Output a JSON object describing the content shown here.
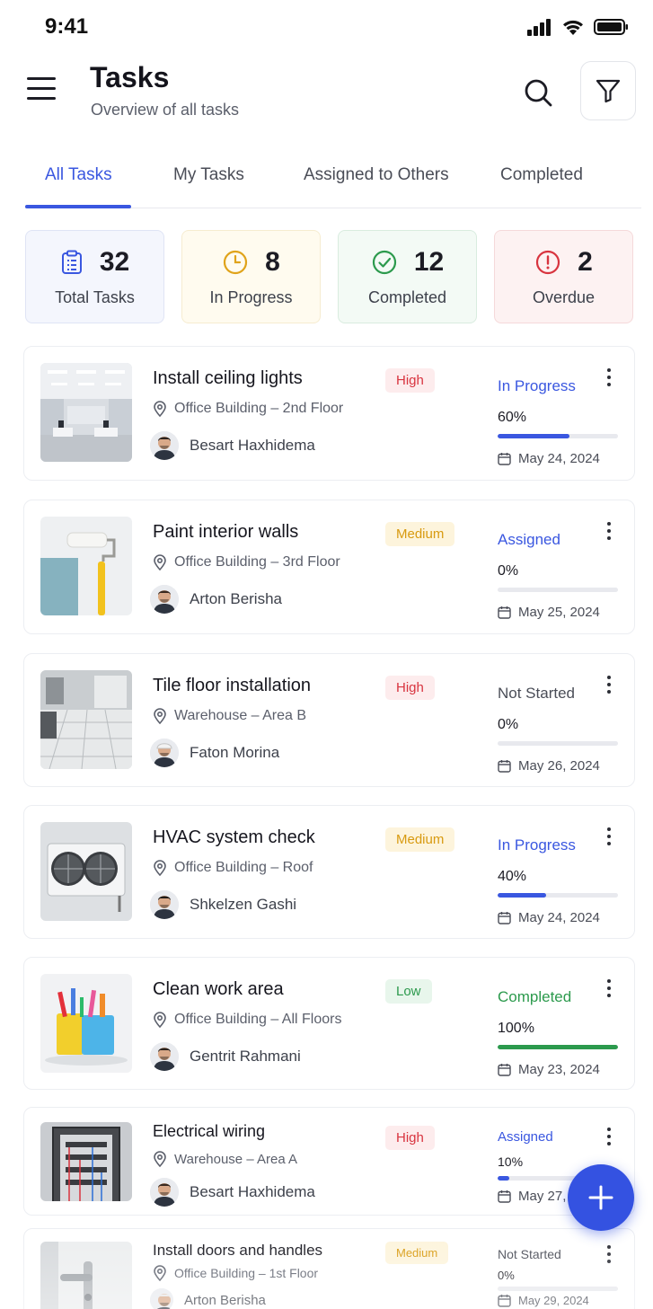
{
  "status_bar": {
    "time": "9:41",
    "icons": [
      "signal-icon",
      "wifi-icon",
      "battery-icon"
    ]
  },
  "header": {
    "title": "Tasks",
    "subtitle": "Overview of all tasks",
    "icons": [
      "menu-icon",
      "search-icon",
      "filter-icon"
    ]
  },
  "tabs": [
    {
      "label": "All Tasks",
      "active": true
    },
    {
      "label": "My Tasks",
      "active": false
    },
    {
      "label": "Assigned to Others",
      "active": false
    },
    {
      "label": "Completed",
      "active": false
    }
  ],
  "stats": [
    {
      "value": "32",
      "label": "Total Tasks",
      "icon": "clipboard-icon",
      "color": "#3a57e0",
      "bg": "#f4f6fd",
      "border": "#dfe4f5"
    },
    {
      "value": "8",
      "label": "In Progress",
      "icon": "clock-icon",
      "color": "#e0a31a",
      "bg": "#fffbef",
      "border": "#f6ecd0"
    },
    {
      "value": "12",
      "label": "Completed",
      "icon": "check-circle-icon",
      "color": "#2c9a4d",
      "bg": "#f3faf5",
      "border": "#d9ecdf"
    },
    {
      "value": "2",
      "label": "Overdue",
      "icon": "alert-circle-icon",
      "color": "#d8343f",
      "bg": "#fdf2f2",
      "border": "#f5d9da"
    }
  ],
  "tasks": [
    {
      "title": "Install ceiling lights",
      "location": "Office Building – 2nd Floor",
      "assignee": "Besart Haxhidema",
      "priority": "High",
      "status": "In Progress",
      "progress": "60%",
      "progress_value": 0.6,
      "date": "May 24, 2024",
      "image": "office-interior-image"
    },
    {
      "title": "Paint interior walls",
      "location": "Office Building – 3rd Floor",
      "assignee": "Arton Berisha",
      "priority": "Medium",
      "status": "Assigned",
      "progress": "0%",
      "progress_value": 0,
      "date": "May 25, 2024",
      "image": "paint-roller-image"
    },
    {
      "title": "Tile floor installation",
      "location": "Warehouse – Area B",
      "assignee": "Faton Morina",
      "priority": "High",
      "status": "Not Started",
      "progress": "0%",
      "progress_value": 0,
      "date": "May 26, 2024",
      "image": "tile-floor-image"
    },
    {
      "title": "HVAC system check",
      "location": "Office Building – Roof",
      "assignee": "Shkelzen Gashi",
      "priority": "Medium",
      "status": "In Progress",
      "progress": "40%",
      "progress_value": 0.4,
      "date": "May 24, 2024",
      "image": "hvac-unit-image"
    },
    {
      "title": "Clean work area",
      "location": "Office Building – All Floors",
      "assignee": "Gentrit Rahmani",
      "priority": "Low",
      "status": "Completed",
      "progress": "100%",
      "progress_value": 1,
      "date": "May 23, 2024",
      "image": "cleaning-supplies-image"
    },
    {
      "title": "Electrical wiring",
      "location": "Warehouse – Area A",
      "assignee": "Besart Haxhidema",
      "priority": "High",
      "status": "Assigned",
      "progress": "10%",
      "progress_value": 0.1,
      "date": "May 27, 2",
      "image": "electrical-panel-image"
    },
    {
      "title": "Install doors and handles",
      "location": "Office Building – 1st Floor",
      "assignee": "Arton Berisha",
      "priority": "Medium",
      "status": "Not Started",
      "progress": "0%",
      "progress_value": 0,
      "date": "May 29, 2024",
      "image": "door-handle-image"
    }
  ],
  "colors": {
    "accent": "#3a57e0",
    "in_progress": "#3a57e0",
    "assigned": "#3a57e0",
    "not_started": "#4a4d57",
    "completed": "#2c9a4d",
    "high": "#d8343f",
    "medium": "#d89a10",
    "low": "#2c9a4d"
  },
  "fab": {
    "icon": "plus-icon"
  }
}
